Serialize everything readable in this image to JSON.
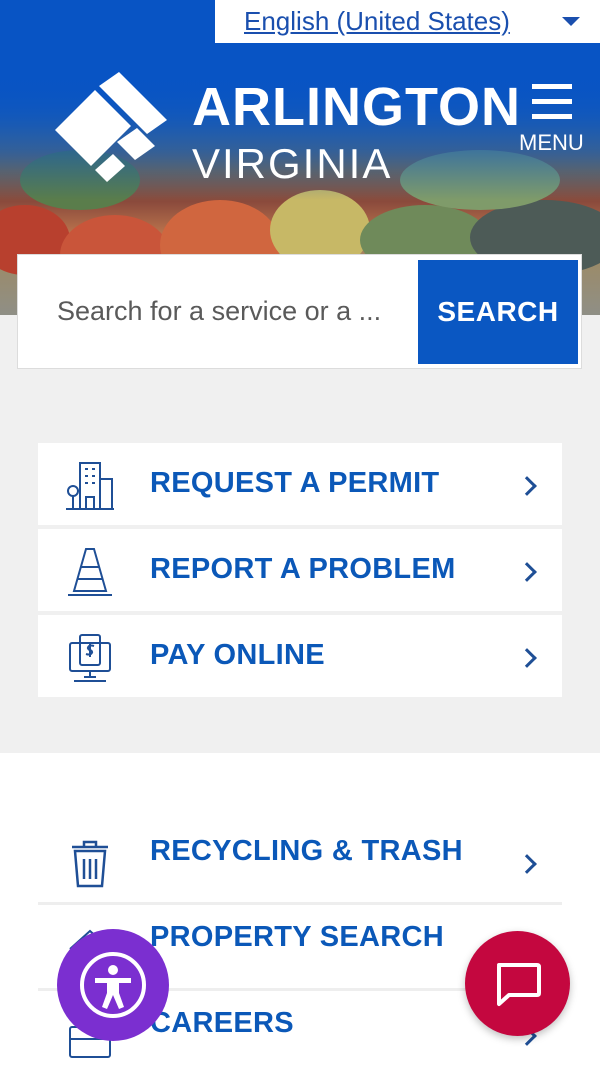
{
  "header": {
    "language": {
      "label": "English (United States)",
      "icon": "chevron-down-icon"
    },
    "logo": {
      "name": "ARLINGTON",
      "state": "VIRGINIA",
      "icon": "arlington-logo-icon"
    },
    "menu": {
      "label": "MENU",
      "icon": "hamburger-icon"
    }
  },
  "search": {
    "placeholder": "Search for a service or a ...",
    "button_label": "SEARCH"
  },
  "quick_actions": [
    {
      "label": "REQUEST A PERMIT",
      "icon": "building-icon"
    },
    {
      "label": "REPORT A PROBLEM",
      "icon": "traffic-cone-icon"
    },
    {
      "label": "PAY ONLINE",
      "icon": "payment-terminal-icon"
    }
  ],
  "links": [
    {
      "label": "RECYCLING & TRASH",
      "icon": "trash-bin-icon"
    },
    {
      "label": "PROPERTY SEARCH",
      "icon": "house-icon"
    },
    {
      "label": "CAREERS",
      "icon": "briefcase-icon"
    }
  ],
  "floating": {
    "accessibility_icon": "accessibility-icon",
    "chat_icon": "chat-bubble-icon"
  },
  "colors": {
    "brand_blue": "#0a57c2",
    "link_blue": "#0b58b8",
    "accessibility_purple": "#7b2fd0",
    "chat_red": "#c4073f",
    "panel_gray": "#f0f0f0"
  }
}
